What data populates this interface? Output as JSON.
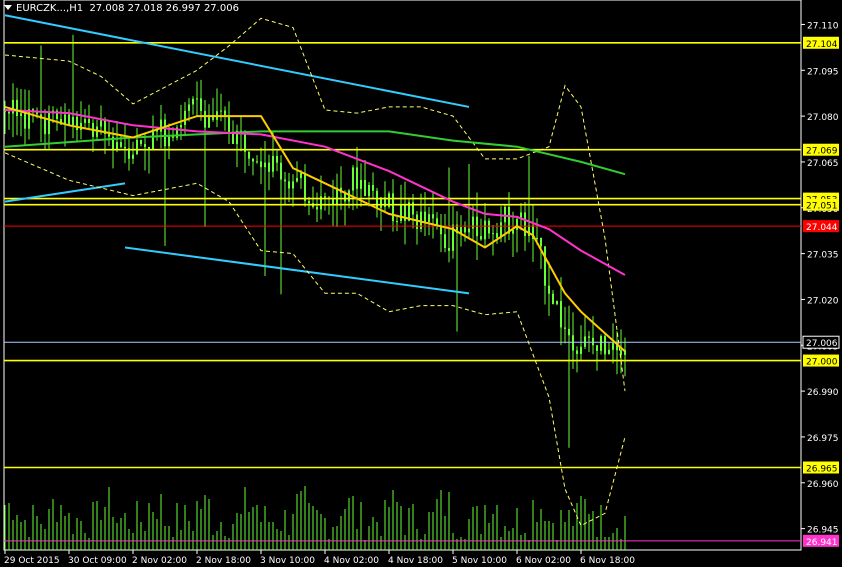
{
  "header": {
    "symbol": "EURCZK...,H1",
    "ohlc": "27.008 27.018 26.997 27.006"
  },
  "colors": {
    "background": "#000000",
    "grid": "#ffffff",
    "candles": "#66ff33",
    "volume": "#66ff33",
    "ma_fast": "#ffcc00",
    "ma_mid": "#ff33cc",
    "ma_slow": "#33cc33",
    "bands": "#ffff66",
    "channel": "#33ccff",
    "level": "#ffff00",
    "resistance": "#ff0000",
    "price_line": "#aaccff",
    "bottom_marker": "#ff33cc"
  },
  "chart_data": {
    "type": "candlestick",
    "title": "EURCZK...,H1",
    "ylim": [
      26.938,
      27.118
    ],
    "y_ticks": [
      "27.110",
      "27.095",
      "27.080",
      "27.065",
      "27.050",
      "27.035",
      "27.020",
      "27.005",
      "26.990",
      "26.975",
      "26.960",
      "26.945"
    ],
    "x_ticks": [
      "29 Oct 2015",
      "30 Oct 09:00",
      "2 Nov 02:00",
      "2 Nov 18:00",
      "3 Nov 10:00",
      "4 Nov 02:00",
      "4 Nov 18:00",
      "5 Nov 10:00",
      "6 Nov 02:00",
      "6 Nov 18:00"
    ],
    "x_tick_index": [
      0,
      16,
      32,
      48,
      64,
      80,
      96,
      112,
      128,
      144
    ],
    "bar_count": 156,
    "horizontal_levels": [
      {
        "value": 27.104,
        "label": "27.104",
        "kind": "level"
      },
      {
        "value": 27.069,
        "label": "27.069",
        "kind": "level"
      },
      {
        "value": 27.053,
        "label": "27.053",
        "kind": "level"
      },
      {
        "value": 27.051,
        "label": "27.051",
        "kind": "level"
      },
      {
        "value": 27.044,
        "label": "27.044",
        "kind": "resistance"
      },
      {
        "value": 27.006,
        "label": "27.006",
        "kind": "price_line"
      },
      {
        "value": 27.0,
        "label": "27.000",
        "kind": "level"
      },
      {
        "value": 26.965,
        "label": "26.965",
        "kind": "level"
      },
      {
        "value": 26.941,
        "label": "26.941",
        "kind": "bottom_marker"
      }
    ],
    "close_anchors": [
      [
        0,
        27.082
      ],
      [
        8,
        27.079
      ],
      [
        16,
        27.078
      ],
      [
        24,
        27.074
      ],
      [
        28,
        27.072
      ],
      [
        32,
        27.07
      ],
      [
        40,
        27.075
      ],
      [
        48,
        27.083
      ],
      [
        56,
        27.076
      ],
      [
        64,
        27.068
      ],
      [
        72,
        27.058
      ],
      [
        80,
        27.052
      ],
      [
        88,
        27.06
      ],
      [
        96,
        27.05
      ],
      [
        104,
        27.046
      ],
      [
        112,
        27.04
      ],
      [
        120,
        27.044
      ],
      [
        128,
        27.047
      ],
      [
        132,
        27.04
      ],
      [
        136,
        27.025
      ],
      [
        140,
        27.01
      ],
      [
        144,
        27.006
      ],
      [
        148,
        27.004
      ],
      [
        152,
        27.008
      ],
      [
        155,
        27.006
      ]
    ],
    "ma_fast": [
      [
        0,
        27.083
      ],
      [
        16,
        27.077
      ],
      [
        32,
        27.073
      ],
      [
        48,
        27.08
      ],
      [
        64,
        27.08
      ],
      [
        72,
        27.063
      ],
      [
        80,
        27.058
      ],
      [
        96,
        27.048
      ],
      [
        112,
        27.043
      ],
      [
        120,
        27.037
      ],
      [
        128,
        27.044
      ],
      [
        132,
        27.041
      ],
      [
        140,
        27.022
      ],
      [
        144,
        27.016
      ],
      [
        155,
        27.003
      ]
    ],
    "ma_mid": [
      [
        0,
        27.082
      ],
      [
        16,
        27.081
      ],
      [
        32,
        27.077
      ],
      [
        48,
        27.075
      ],
      [
        64,
        27.074
      ],
      [
        80,
        27.07
      ],
      [
        96,
        27.062
      ],
      [
        112,
        27.052
      ],
      [
        120,
        27.048
      ],
      [
        128,
        27.047
      ],
      [
        136,
        27.043
      ],
      [
        144,
        27.036
      ],
      [
        155,
        27.028
      ]
    ],
    "ma_slow": [
      [
        0,
        27.07
      ],
      [
        32,
        27.073
      ],
      [
        64,
        27.075
      ],
      [
        96,
        27.075
      ],
      [
        112,
        27.072
      ],
      [
        128,
        27.07
      ],
      [
        144,
        27.065
      ],
      [
        155,
        27.061
      ]
    ],
    "bands_upper": [
      [
        0,
        27.1
      ],
      [
        16,
        27.098
      ],
      [
        24,
        27.093
      ],
      [
        32,
        27.084
      ],
      [
        48,
        27.095
      ],
      [
        56,
        27.103
      ],
      [
        64,
        27.112
      ],
      [
        72,
        27.109
      ],
      [
        80,
        27.082
      ],
      [
        88,
        27.081
      ],
      [
        96,
        27.083
      ],
      [
        104,
        27.083
      ],
      [
        112,
        27.08
      ],
      [
        120,
        27.066
      ],
      [
        128,
        27.066
      ],
      [
        136,
        27.07
      ],
      [
        140,
        27.09
      ],
      [
        144,
        27.083
      ],
      [
        150,
        27.04
      ],
      [
        155,
        26.99
      ]
    ],
    "bands_lower": [
      [
        0,
        27.068
      ],
      [
        16,
        27.059
      ],
      [
        32,
        27.054
      ],
      [
        48,
        27.058
      ],
      [
        56,
        27.052
      ],
      [
        64,
        27.036
      ],
      [
        72,
        27.035
      ],
      [
        80,
        27.022
      ],
      [
        88,
        27.022
      ],
      [
        96,
        27.016
      ],
      [
        104,
        27.018
      ],
      [
        112,
        27.018
      ],
      [
        120,
        27.015
      ],
      [
        128,
        27.016
      ],
      [
        136,
        26.988
      ],
      [
        140,
        26.958
      ],
      [
        144,
        26.946
      ],
      [
        150,
        26.95
      ],
      [
        155,
        26.975
      ]
    ],
    "channel_lines": [
      {
        "from": [
          0,
          27.113
        ],
        "to": [
          116,
          27.083
        ]
      },
      {
        "from": [
          0,
          27.052
        ],
        "to": [
          30,
          27.058
        ]
      },
      {
        "from": [
          30,
          27.037
        ],
        "to": [
          116,
          27.022
        ]
      }
    ]
  }
}
